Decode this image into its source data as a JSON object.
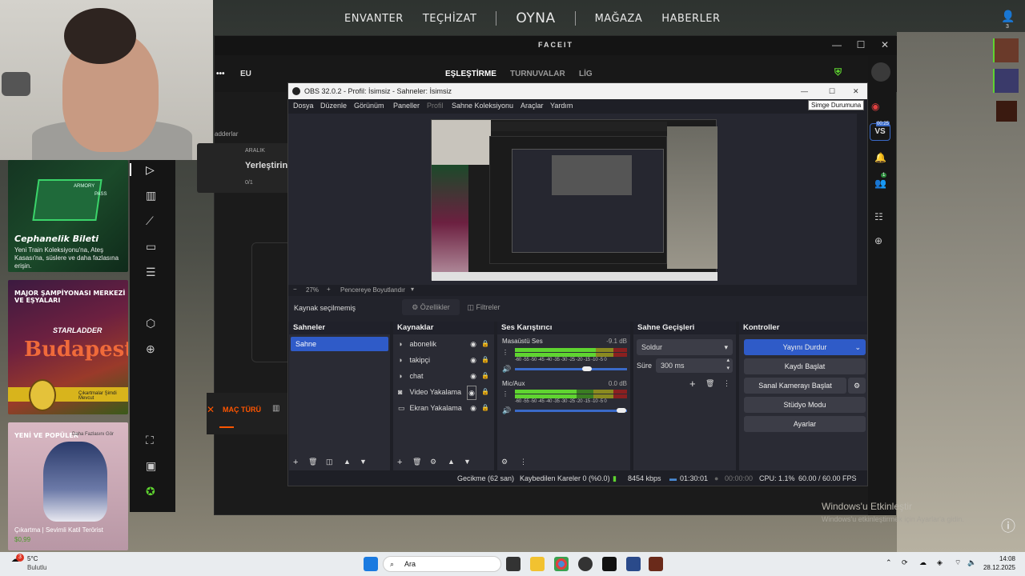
{
  "game_nav": {
    "items": [
      "ENVANTER",
      "TEÇHİZAT",
      "OYNA",
      "MAĞAZA",
      "HABERLER"
    ],
    "friends_count": "3"
  },
  "side_cards": {
    "armory_title": "Cephanelik Bileti",
    "armory_badge": "ARMORY",
    "armory_pass": "PASS",
    "armory_desc": "Yeni Train Koleksiyonu'na, Ateş Kasası'na, süslere ve daha fazlasına erişin.",
    "major_title": "MAJOR ŞAMPİYONASI MERKEZİ VE EŞYALARI",
    "major_brand": "STARLADDER",
    "major_city": "Budapest",
    "major_sub": "Çıkartmalar Şimdi Mevcut",
    "new_title": "YENİ VE POPÜLER",
    "new_more": "Daha Fazlasını Gör",
    "new_item": "Çıkartma | Sevimli Katil Terörist",
    "new_price": "$0,99",
    "info_icon": "i"
  },
  "faceit": {
    "title": "FACEIT",
    "region": "EU",
    "tabs": [
      "EŞLEŞTİRME",
      "TURNUVALAR",
      "LİG"
    ],
    "ladders": "adderlar",
    "range_label": "ARALIK",
    "placement": "Yerleştirin",
    "progress": "0/1",
    "match_type": "MAÇ TÜRÜ",
    "vs": "VS",
    "vs_badge": "00:25",
    "notif_badge": "1"
  },
  "obs": {
    "title": "OBS 32.0.2 - Profil: İsimsiz - Sahneler: İsimsiz",
    "menu": [
      "Dosya",
      "Düzenle",
      "Görünüm",
      "Paneller",
      "Profil",
      "Sahne Koleksiyonu",
      "Araçlar",
      "Yardım"
    ],
    "tooltip": "Simge Durumuna",
    "zoom": "27%",
    "zoom_mode": "Pencereye Boyutlandır",
    "no_source": "Kaynak seçilmemiş",
    "properties": "Özellikler",
    "filters": "Filtreler",
    "scenes_title": "Sahneler",
    "scenes": [
      "Sahne"
    ],
    "sources_title": "Kaynaklar",
    "sources": [
      {
        "name": "abonelik",
        "icon": "browser-icon"
      },
      {
        "name": "takipçi",
        "icon": "browser-icon"
      },
      {
        "name": "chat",
        "icon": "browser-icon"
      },
      {
        "name": "Video Yakalama",
        "icon": "camera-icon"
      },
      {
        "name": "Ekran Yakalama",
        "icon": "monitor-icon"
      }
    ],
    "mixer_title": "Ses Karıştırıcı",
    "mixer": [
      {
        "name": "Masaüstü Ses",
        "db": "-9.1 dB",
        "level": 0.72,
        "volume": 0.64
      },
      {
        "name": "Mic/Aux",
        "db": "0.0 dB",
        "level": 0.55,
        "volume": 0.95
      }
    ],
    "meter_scale": "-60 -55 -50 -45 -40 -35 -30 -25 -20 -15 -10 -5 0",
    "transitions_title": "Sahne Geçişleri",
    "transition": "Soldur",
    "duration_label": "Süre",
    "duration": "300 ms",
    "controls_title": "Kontroller",
    "controls": {
      "stream": "Yayını Durdur",
      "record": "Kaydı Başlat",
      "vcam": "Sanal Kamerayı Başlat",
      "studio": "Stüdyo Modu",
      "settings": "Ayarlar"
    },
    "status": {
      "delay": "Gecikme (62 san)",
      "dropped": "Kaybedilen Kareler 0 (%0.0)",
      "bitrate": "8454 kbps",
      "live_time": "01:30:01",
      "rec_time": "00:00:00",
      "cpu": "CPU: 1.1%",
      "fps": "60.00 / 60.00 FPS"
    }
  },
  "watermark": {
    "line1": "Windows'u Etkinleştir",
    "line2": "Windows'u etkinleştirmek için Ayarlar'a gidin."
  },
  "taskbar": {
    "weather_temp": "5°C",
    "weather_desc": "Bulutlu",
    "weather_badge": "3",
    "search": "Ara",
    "time": "14:08",
    "date": "28.12.2025"
  }
}
